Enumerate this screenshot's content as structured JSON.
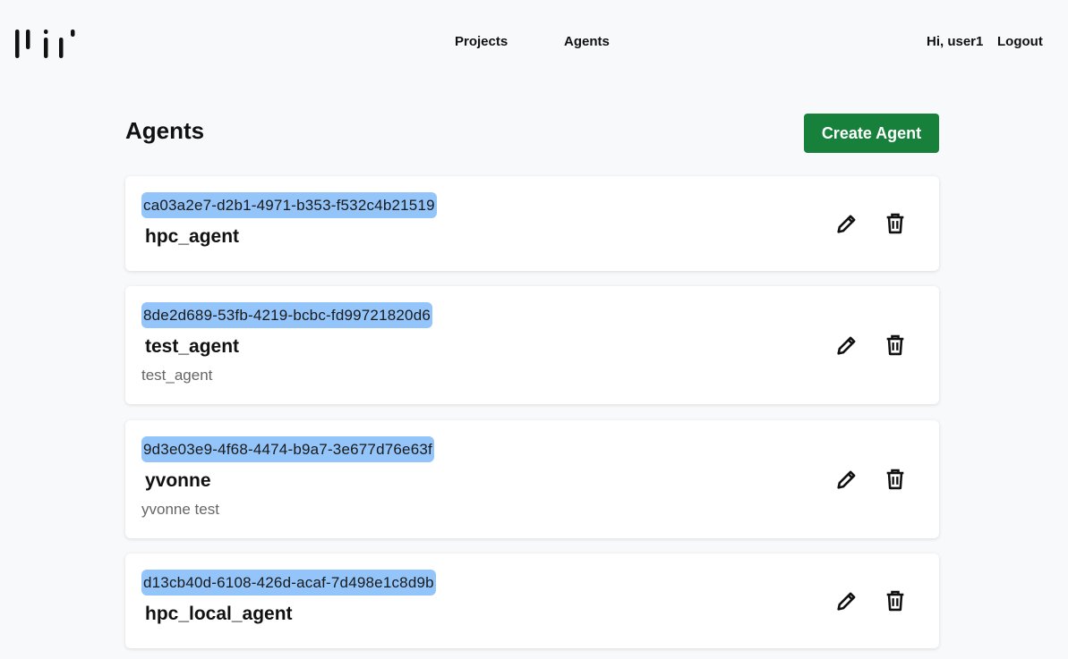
{
  "nav": {
    "logo_icon": "brand-logo-icon",
    "links": [
      "Projects",
      "Agents"
    ],
    "greeting": "Hi, user1",
    "logout": "Logout"
  },
  "page": {
    "title": "Agents",
    "create_button": "Create Agent"
  },
  "agents": [
    {
      "id": "ca03a2e7-d2b1-4971-b353-f532c4b21519",
      "name": "hpc_agent",
      "description": ""
    },
    {
      "id": "8de2d689-53fb-4219-bcbc-fd99721820d6",
      "name": "test_agent",
      "description": "test_agent"
    },
    {
      "id": "9d3e03e9-4f68-4474-b9a7-3e677d76e63f",
      "name": "yvonne",
      "description": "yvonne test"
    },
    {
      "id": "d13cb40d-6108-426d-acaf-7d498e1c8d9b",
      "name": "hpc_local_agent",
      "description": ""
    }
  ],
  "colors": {
    "accent": "#17813c",
    "id_badge": "#93c4fa",
    "background": "#f8f9fb"
  },
  "icons": {
    "edit": "pencil-icon",
    "delete": "trash-icon"
  }
}
